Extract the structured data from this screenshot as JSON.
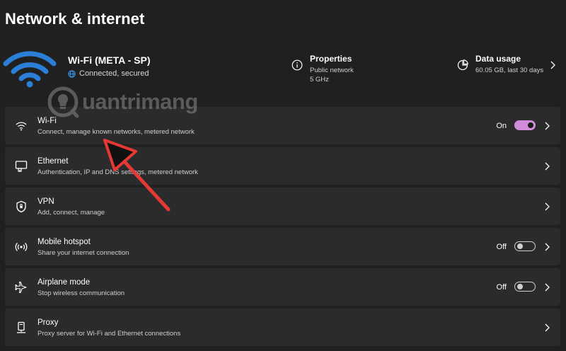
{
  "page": {
    "title": "Network & internet"
  },
  "summary": {
    "network_name": "Wi-Fi (META - SP)",
    "network_status": "Connected, secured",
    "properties": {
      "title": "Properties",
      "line1": "Public network",
      "line2": "5 GHz"
    },
    "data_usage": {
      "title": "Data usage",
      "line1": "60.05 GB, last 30 days"
    }
  },
  "rows": [
    {
      "title": "Wi-Fi",
      "subtitle": "Connect, manage known networks, metered network",
      "toggle_label": "On",
      "icon": "wifi-icon"
    },
    {
      "title": "Ethernet",
      "subtitle": "Authentication, IP and DNS settings, metered network",
      "icon": "ethernet-icon"
    },
    {
      "title": "VPN",
      "subtitle": "Add, connect, manage",
      "icon": "shield-icon"
    },
    {
      "title": "Mobile hotspot",
      "subtitle": "Share your internet connection",
      "toggle_label": "Off",
      "icon": "hotspot-icon"
    },
    {
      "title": "Airplane mode",
      "subtitle": "Stop wireless communication",
      "toggle_label": "Off",
      "icon": "airplane-icon"
    },
    {
      "title": "Proxy",
      "subtitle": "Proxy server for Wi-Fi and Ethernet connections",
      "icon": "proxy-icon"
    }
  ],
  "watermark": {
    "text": "uantrimang"
  },
  "colors": {
    "accent": "#d28cdc",
    "wifi_blue": "#2b7fd6",
    "arrow_red": "#e53935",
    "row_bg": "#2b2b2b",
    "page_bg": "#202020"
  }
}
